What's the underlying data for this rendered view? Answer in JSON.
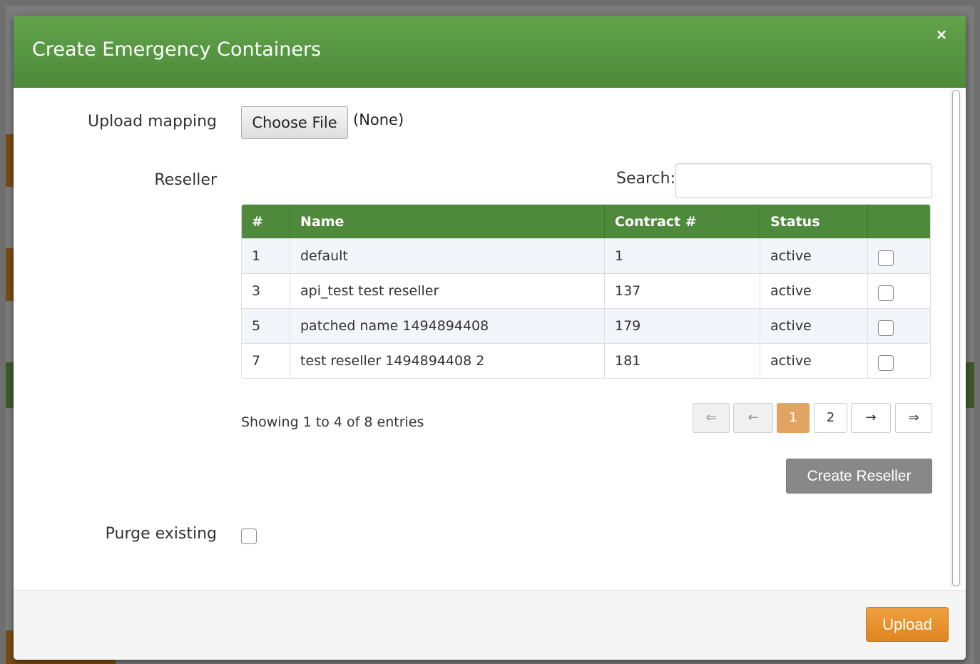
{
  "modal": {
    "title": "Create Emergency Containers",
    "close_symbol": "×"
  },
  "form": {
    "upload_label": "Upload mapping",
    "choose_file_label": "Choose File",
    "file_status": "(None)",
    "reseller_label": "Reseller",
    "search_label": "Search:",
    "search_value": "",
    "purge_label": "Purge existing",
    "purge_checked": false
  },
  "table": {
    "headers": [
      "#",
      "Name",
      "Contract #",
      "Status",
      ""
    ],
    "rows": [
      {
        "id": "1",
        "name": "default",
        "contract": "1",
        "status": "active",
        "checked": false
      },
      {
        "id": "3",
        "name": "api_test test reseller",
        "contract": "137",
        "status": "active",
        "checked": false
      },
      {
        "id": "5",
        "name": "patched name 1494894408",
        "contract": "179",
        "status": "active",
        "checked": false
      },
      {
        "id": "7",
        "name": "test reseller 1494894408 2",
        "contract": "181",
        "status": "active",
        "checked": false
      }
    ]
  },
  "pagination": {
    "info": "Showing 1 to 4 of 8 entries",
    "first": "⇐",
    "prev": "←",
    "pages": [
      "1",
      "2"
    ],
    "current_page": "1",
    "next": "→",
    "last": "⇒"
  },
  "buttons": {
    "create_reseller": "Create Reseller",
    "upload": "Upload"
  },
  "colors": {
    "header_green": "#5a9a44",
    "table_header_green": "#4f8a3c",
    "accent_orange": "#e8952e",
    "active_page": "#e3a462"
  }
}
